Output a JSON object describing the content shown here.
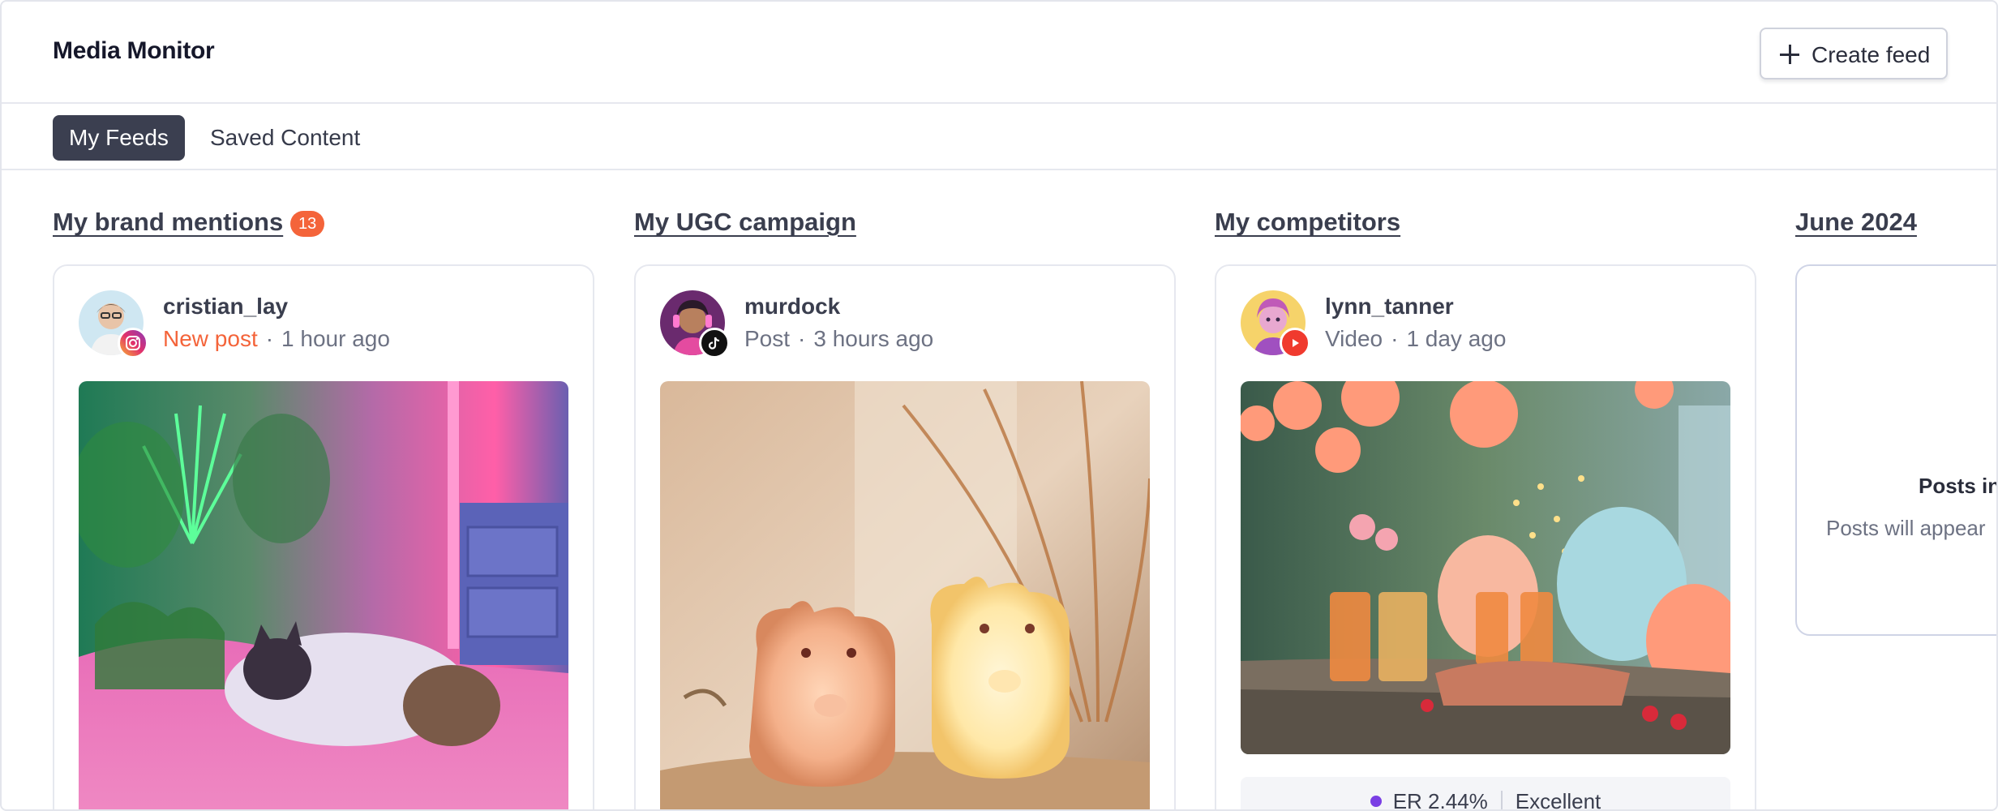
{
  "app": {
    "title": "Media Monitor"
  },
  "header": {
    "create_button_label": "Create feed"
  },
  "tabs": [
    {
      "label": "My Feeds",
      "active": true
    },
    {
      "label": "Saved Content",
      "active": false
    }
  ],
  "columns": [
    {
      "title": "My brand mentions",
      "badge_count": "13",
      "post": {
        "username": "cristian_lay",
        "type": "New post",
        "time": "1 hour ago",
        "platform": "instagram-icon"
      }
    },
    {
      "title": "My UGC campaign",
      "post": {
        "username": "murdock",
        "type": "Post",
        "time": "3 hours ago",
        "platform": "tiktok-icon"
      }
    },
    {
      "title": "My competitors",
      "post": {
        "username": "lynn_tanner",
        "type": "Video",
        "time": "1 day ago",
        "platform": "youtube-icon",
        "engagement": {
          "rate": "ER 2.44%",
          "quality": "Excellent"
        }
      }
    },
    {
      "title": "June 2024",
      "empty_title": "Posts in",
      "empty_message": "Posts will appear"
    }
  ],
  "colors": {
    "accent": "#f4643a",
    "tab_active_bg": "#3b3f50",
    "engagement_dot": "#7a3fe4"
  }
}
